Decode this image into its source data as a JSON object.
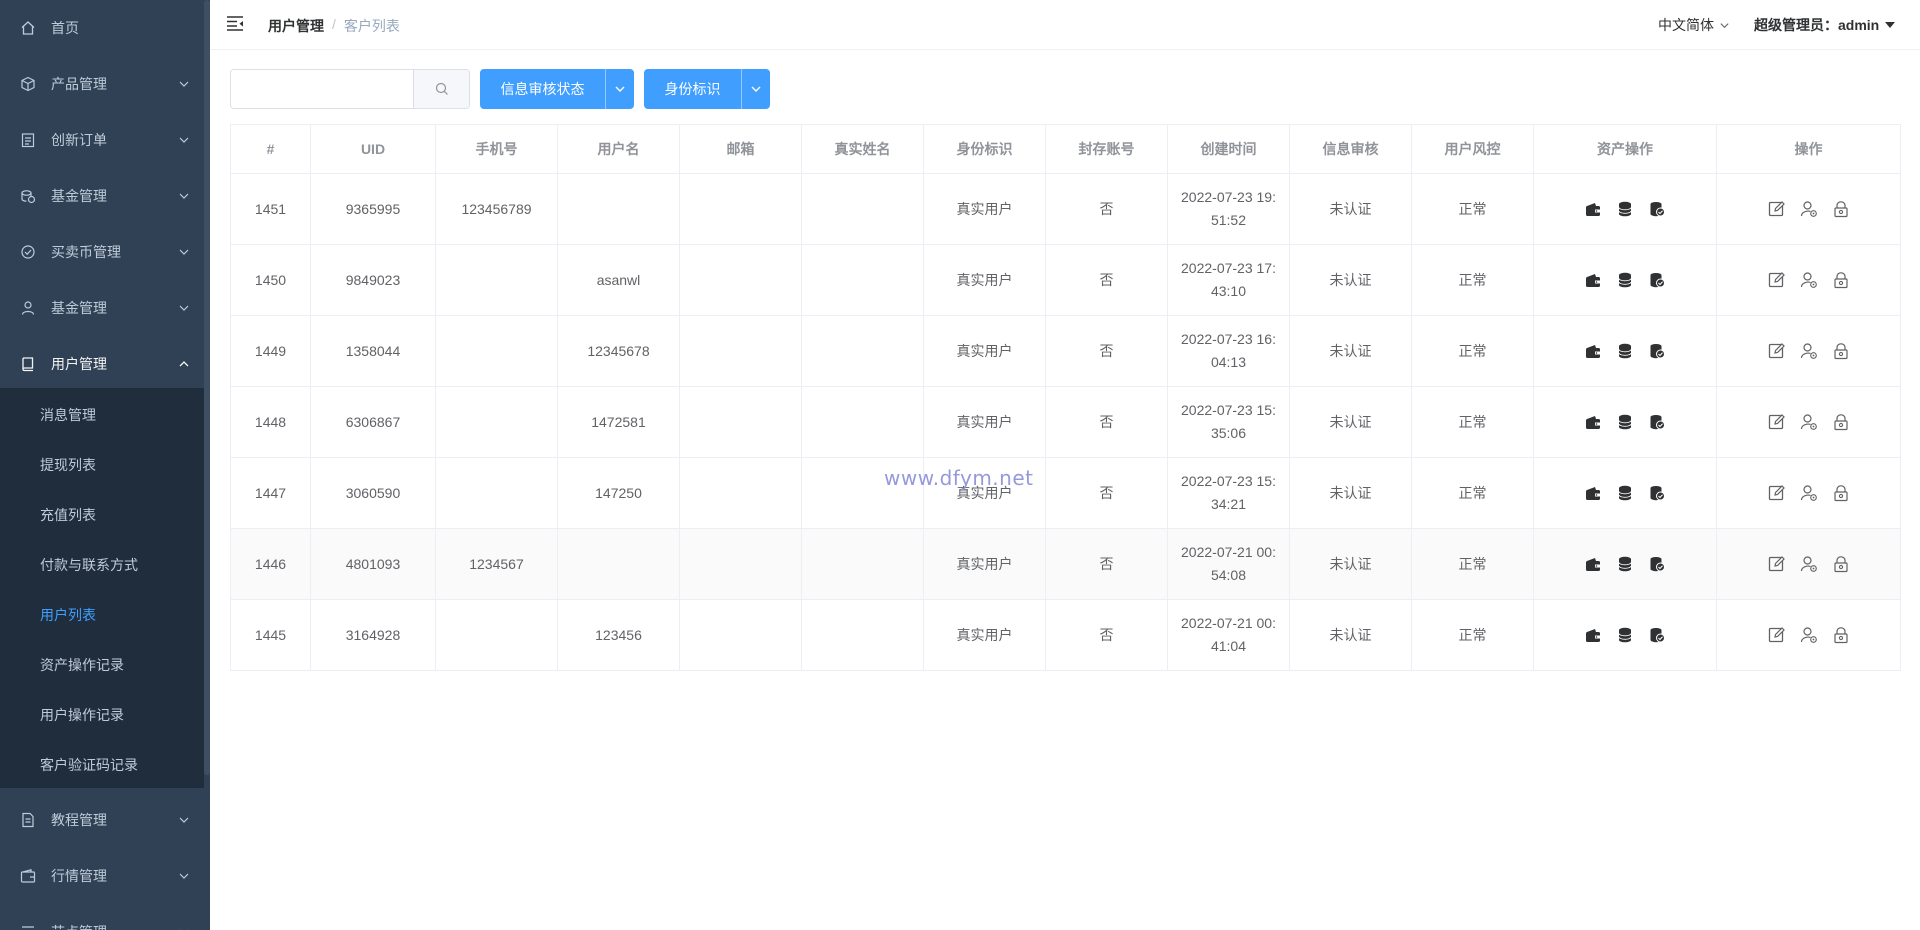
{
  "sidebar": {
    "items": [
      {
        "label": "首页",
        "icon": "home-icon"
      },
      {
        "label": "产品管理",
        "icon": "box-icon"
      },
      {
        "label": "创新订单",
        "icon": "order-icon"
      },
      {
        "label": "基金管理",
        "icon": "coins-icon"
      },
      {
        "label": "买卖币管理",
        "icon": "check-circle-icon"
      },
      {
        "label": "基金管理",
        "icon": "user-icon"
      },
      {
        "label": "用户管理",
        "icon": "book-icon"
      },
      {
        "label": "教程管理",
        "icon": "document-icon"
      },
      {
        "label": "行情管理",
        "icon": "wallet-icon"
      },
      {
        "label": "节点管理",
        "icon": "settings-icon"
      }
    ],
    "sub_items": [
      {
        "label": "消息管理"
      },
      {
        "label": "提现列表"
      },
      {
        "label": "充值列表"
      },
      {
        "label": "付款与联系方式"
      },
      {
        "label": "用户列表"
      },
      {
        "label": "资产操作记录"
      },
      {
        "label": "用户操作记录"
      },
      {
        "label": "客户验证码记录"
      }
    ],
    "active_sub": "用户列表"
  },
  "header": {
    "breadcrumb": [
      "用户管理",
      "客户列表"
    ],
    "separator": "/",
    "language": "中文简体",
    "user": "超级管理员：admin"
  },
  "toolbar": {
    "search_value": "",
    "filter_status": "信息审核状态",
    "filter_identity": "身份标识"
  },
  "table": {
    "columns": [
      "#",
      "UID",
      "手机号",
      "用户名",
      "邮箱",
      "真实姓名",
      "身份标识",
      "封存账号",
      "创建时间",
      "信息审核",
      "用户风控",
      "资产操作",
      "操作"
    ],
    "rows": [
      {
        "id": "1451",
        "uid": "9365995",
        "phone": "123456789",
        "username": "",
        "email": "",
        "realname": "",
        "identity": "真实用户",
        "sealed": "否",
        "time1": "2022-07-23 19:",
        "time2": "51:52",
        "audit": "未认证",
        "risk": "正常"
      },
      {
        "id": "1450",
        "uid": "9849023",
        "phone": "",
        "username": "asanwl",
        "email": "",
        "realname": "",
        "identity": "真实用户",
        "sealed": "否",
        "time1": "2022-07-23 17:",
        "time2": "43:10",
        "audit": "未认证",
        "risk": "正常"
      },
      {
        "id": "1449",
        "uid": "1358044",
        "phone": "",
        "username": "12345678",
        "email": "",
        "realname": "",
        "identity": "真实用户",
        "sealed": "否",
        "time1": "2022-07-23 16:",
        "time2": "04:13",
        "audit": "未认证",
        "risk": "正常"
      },
      {
        "id": "1448",
        "uid": "6306867",
        "phone": "",
        "username": "1472581",
        "email": "",
        "realname": "",
        "identity": "真实用户",
        "sealed": "否",
        "time1": "2022-07-23 15:",
        "time2": "35:06",
        "audit": "未认证",
        "risk": "正常"
      },
      {
        "id": "1447",
        "uid": "3060590",
        "phone": "",
        "username": "147250",
        "email": "",
        "realname": "",
        "identity": "真实用户",
        "sealed": "否",
        "time1": "2022-07-23 15:",
        "time2": "34:21",
        "audit": "未认证",
        "risk": "正常"
      },
      {
        "id": "1446",
        "uid": "4801093",
        "phone": "1234567",
        "username": "",
        "email": "",
        "realname": "",
        "identity": "真实用户",
        "sealed": "否",
        "time1": "2022-07-21 00:",
        "time2": "54:08",
        "audit": "未认证",
        "risk": "正常"
      },
      {
        "id": "1445",
        "uid": "3164928",
        "phone": "",
        "username": "123456",
        "email": "",
        "realname": "",
        "identity": "真实用户",
        "sealed": "否",
        "time1": "2022-07-21 00:",
        "time2": "41:04",
        "audit": "未认证",
        "risk": "正常"
      }
    ]
  },
  "watermark": "www.dfym.net",
  "colors": {
    "sidebar_bg": "#304156",
    "submenu_bg": "#1f2d3d",
    "accent": "#409eff"
  }
}
